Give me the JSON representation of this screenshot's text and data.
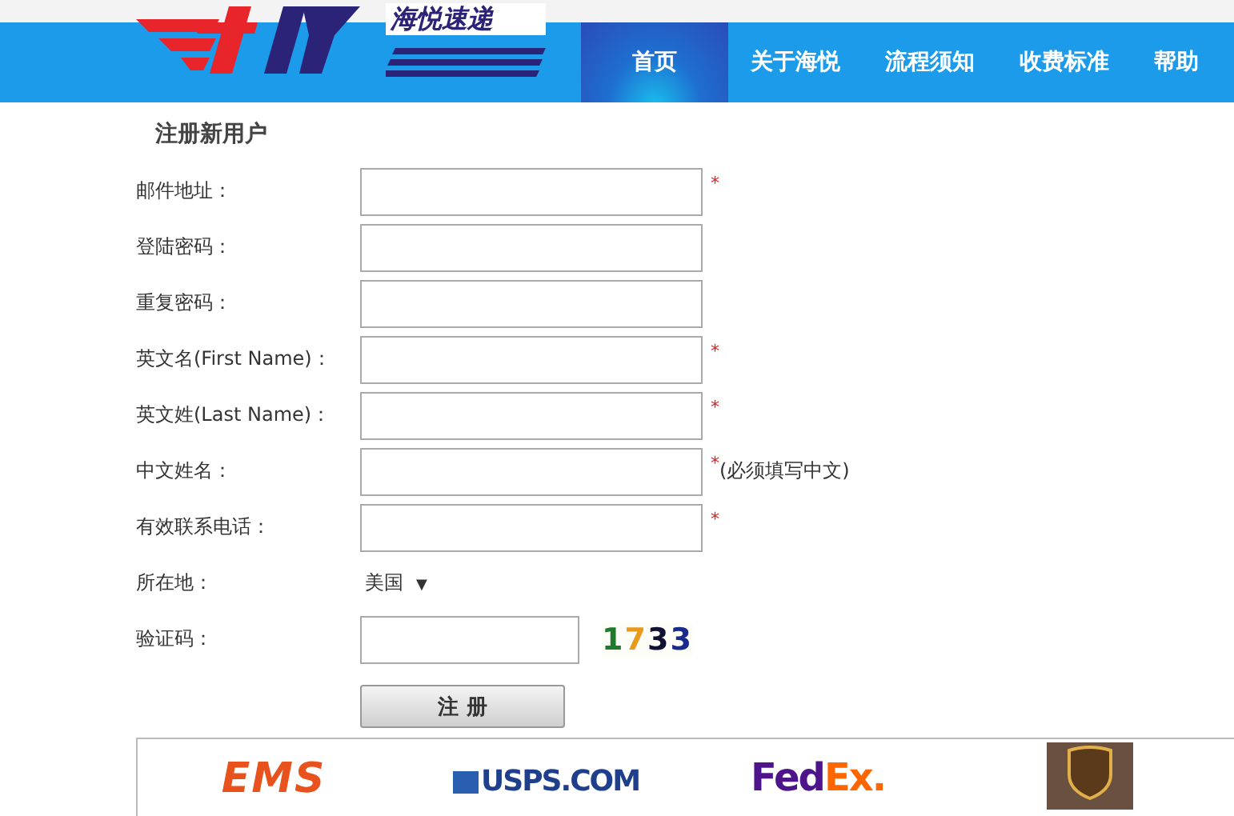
{
  "header": {
    "brand": "海悦速递",
    "nav": [
      {
        "label": "首页",
        "selected": true
      },
      {
        "label": "关于海悦",
        "selected": false
      },
      {
        "label": "流程须知",
        "selected": false
      },
      {
        "label": "收费标准",
        "selected": false
      },
      {
        "label": "帮助",
        "selected": false
      }
    ]
  },
  "form": {
    "title": "注册新用户",
    "fields": [
      {
        "kind": "input",
        "label": "邮件地址：",
        "mark": "*"
      },
      {
        "kind": "input",
        "label": "登陆密码："
      },
      {
        "kind": "input",
        "label": "重复密码："
      },
      {
        "kind": "input",
        "label": "英文名(First Name)：",
        "mark": "*"
      },
      {
        "kind": "input",
        "label": "英文姓(Last Name)：",
        "mark": "*"
      },
      {
        "kind": "input",
        "label": "中文姓名：",
        "mark": "*",
        "note": "(必须填写中文)"
      },
      {
        "kind": "input",
        "label": "有效联系电话：",
        "mark": "*"
      },
      {
        "kind": "select",
        "label": "所在地：",
        "value": "美国",
        "caret": "▼"
      },
      {
        "kind": "captcha",
        "label": "验证码：",
        "captcha": [
          {
            "text": "1",
            "color": "#1f7a2c"
          },
          {
            "text": "7",
            "color": "#e89a1c"
          },
          {
            "text": "3",
            "color": "#111133"
          },
          {
            "text": "3",
            "color": "#1a2a8c"
          }
        ]
      }
    ],
    "submit": "注 册"
  },
  "carriers": [
    {
      "kind": "ems",
      "text": "EMS"
    },
    {
      "kind": "usps",
      "text": "USPS.COM"
    },
    {
      "kind": "fedex",
      "parts": [
        "Fed",
        "Ex."
      ]
    },
    {
      "kind": "ups"
    }
  ]
}
